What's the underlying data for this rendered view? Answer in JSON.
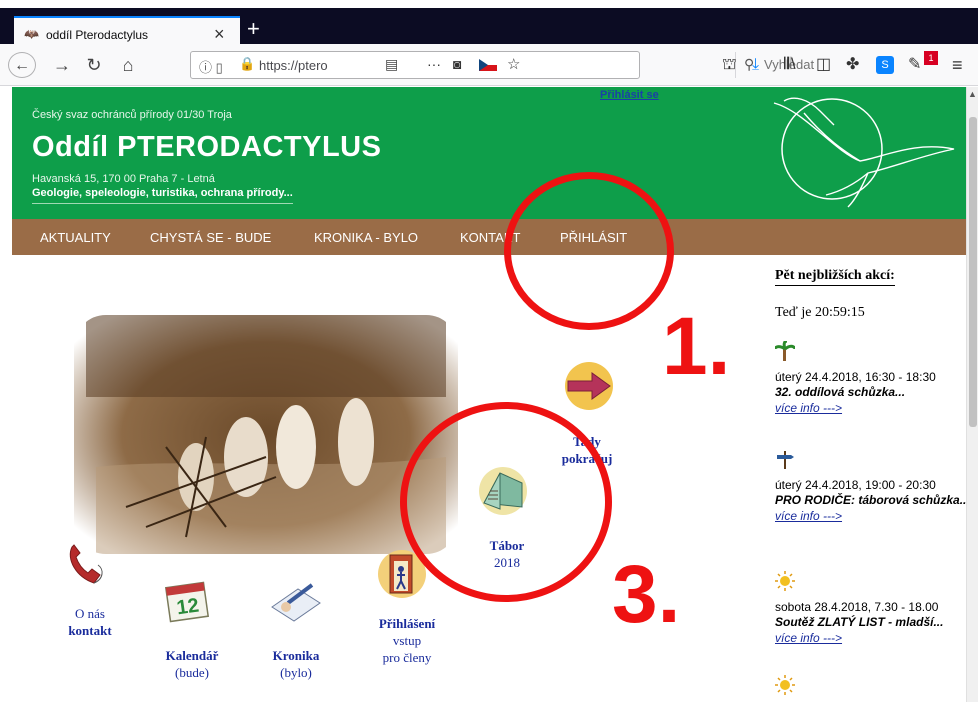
{
  "browser": {
    "tab_title": "oddíl Pterodactylus",
    "tab_close": "×",
    "new_tab": "+",
    "url": "https://ptero",
    "search_placeholder": "Vyhledat",
    "extension_badge": "1",
    "extension_s": "S"
  },
  "header": {
    "org_line": "Český svaz ochránců přírody 01/30 Troja",
    "title": "Oddíl PTERODACTYLUS",
    "address": "Havanská 15, 170 00 Praha 7 - Letná",
    "topics": "Geologie, speleologie, turistika, ochrana přírody...",
    "login_link": "Přihlásit se"
  },
  "menu": [
    "AKTUALITY",
    "CHYSTÁ SE - BUDE",
    "KRONIKA - BYLO",
    "KONTAKT",
    "PŘIHLÁSIT"
  ],
  "links": {
    "contact": {
      "line1": "O nás",
      "line2": "kontakt"
    },
    "calendar": {
      "line1": "Kalendář",
      "line2": "(bude)",
      "icon_number": "12"
    },
    "chronicle": {
      "line1": "Kronika",
      "line2": "(bylo)"
    },
    "login": {
      "line1": "Přihlášení",
      "line2": "vstup",
      "line3": "pro členy"
    },
    "camp": {
      "line1": "Tábor",
      "line2": "2018"
    },
    "continue": {
      "line1": "Tady",
      "line2": "pokračuj"
    }
  },
  "sidebar": {
    "heading": "Pět nejbližších akcí:",
    "time": "Teď je 20:59:15",
    "events": [
      {
        "date": "úterý 24.4.2018, 16:30 - 18:30",
        "title": "32. oddílová schůzka...",
        "more": "více info --->",
        "icon": "palm-tree-icon"
      },
      {
        "date": "úterý 24.4.2018, 19:00 - 20:30",
        "title": "PRO RODIČE: táborová schůzka...",
        "more": "více info --->",
        "icon": "signpost-icon"
      },
      {
        "date": "sobota 28.4.2018, 7.30 - 18.00",
        "title": "Soutěž ZLATÝ LIST - mladší...",
        "more": "více info --->",
        "icon": "sun-icon"
      }
    ]
  },
  "annotations": {
    "num1": "1.",
    "num3": "3."
  },
  "colors": {
    "header_green": "#0e9e4a",
    "menu_brown": "#9a6c47",
    "annotation_red": "#ee1212",
    "link_blue": "#1a2c9c"
  }
}
